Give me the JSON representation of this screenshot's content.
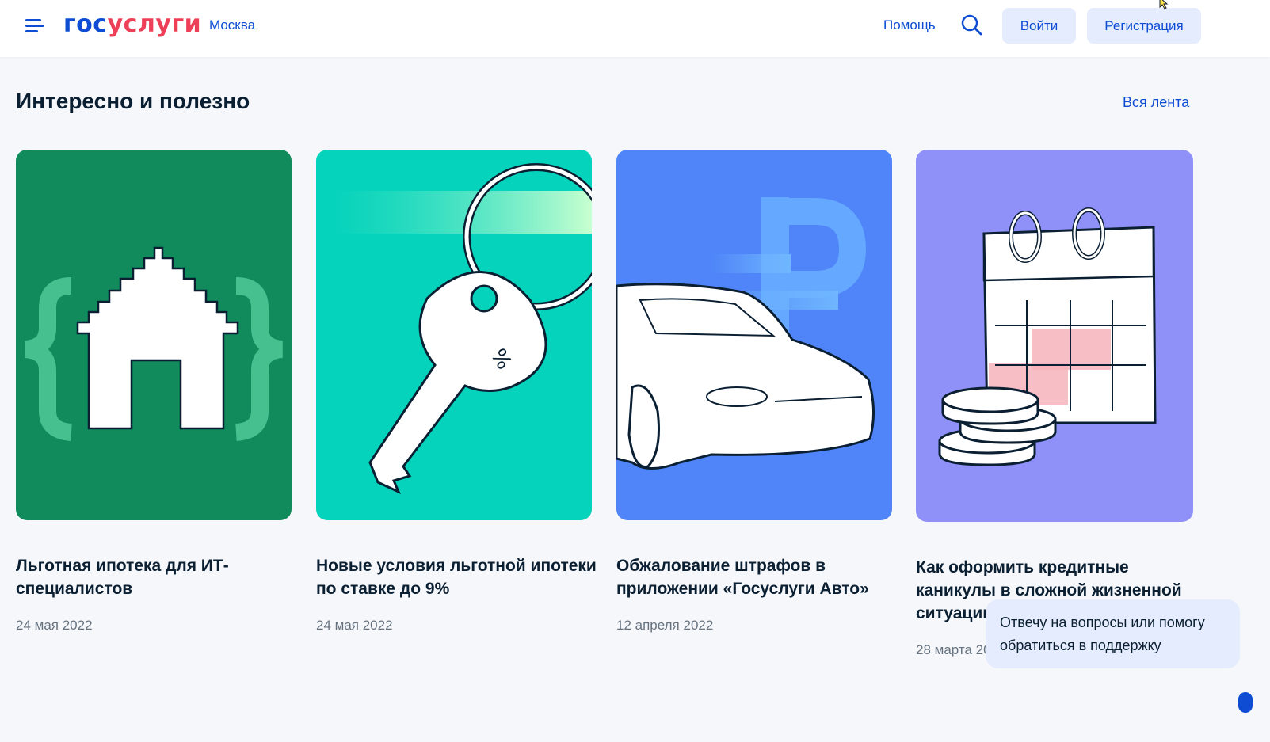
{
  "header": {
    "logo_part1": "гос",
    "logo_part2": "услуги",
    "city": "Москва",
    "help": "Помощь",
    "login": "Войти",
    "register": "Регистрация"
  },
  "section": {
    "title": "Интересно и полезно",
    "all_link": "Вся лента"
  },
  "cards": [
    {
      "title": "Льготная ипотека для ИТ-специалистов",
      "date": "24 мая 2022",
      "bg": "#118a5c"
    },
    {
      "title": "Новые условия льготной ипотеки по ставке до 9%",
      "date": "24 мая 2022",
      "bg": "#05d3bb"
    },
    {
      "title": "Обжалование штрафов в приложении «Госуслуги Авто»",
      "date": "12 апреля 2022",
      "bg": "#4f85f8"
    },
    {
      "title": "Как оформить кредитные каникулы в сложной жизненной ситуации",
      "date": "28 марта 2022",
      "bg": "#8f91f9"
    }
  ],
  "chat": {
    "text": "Отвечу на вопросы или помогу обратиться в поддержку"
  },
  "colors": {
    "brand_blue": "#0d4cd3",
    "brand_red": "#ee3f58",
    "button_bg": "#e4ecfd",
    "page_bg": "#f5f7fa"
  },
  "icons": [
    "menu-icon",
    "search-icon",
    "house-icon",
    "key-icon",
    "car-icon",
    "ruble-icon",
    "calendar-icon",
    "coins-icon"
  ]
}
